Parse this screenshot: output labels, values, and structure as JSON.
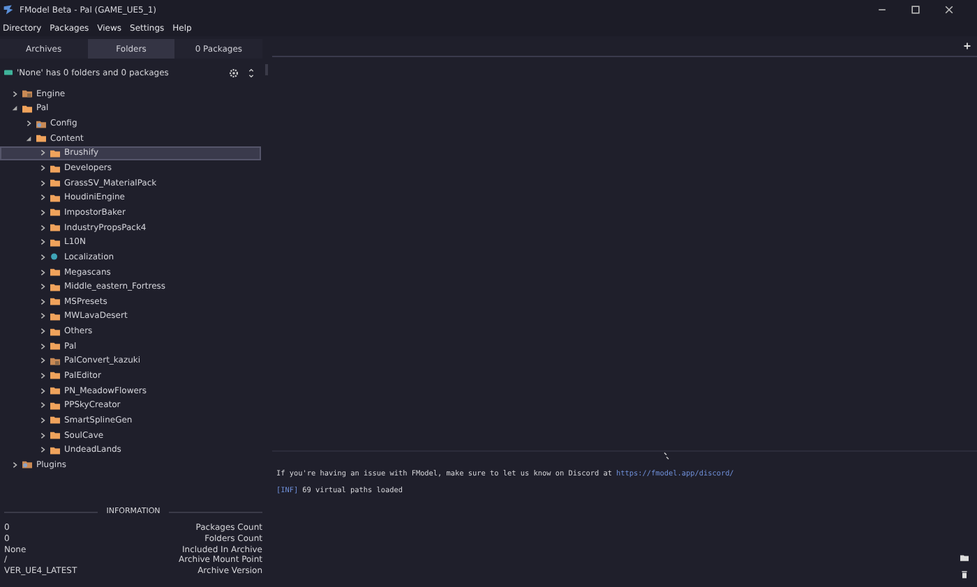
{
  "window": {
    "title": "FModel Beta - Pal (GAME_UE5_1)"
  },
  "menu": [
    "Directory",
    "Packages",
    "Views",
    "Settings",
    "Help"
  ],
  "tabs": [
    {
      "label": "Archives",
      "selected": false
    },
    {
      "label": "Folders",
      "selected": true
    },
    {
      "label": "0 Packages",
      "selected": false
    }
  ],
  "status": "'None' has 0 folders and 0 packages",
  "tree": [
    {
      "label": "Engine",
      "kind": "plugin",
      "expanded": false,
      "selected": false
    },
    {
      "label": "Pal",
      "kind": "folder",
      "expanded": true,
      "selected": false,
      "children": [
        {
          "label": "Config",
          "kind": "config",
          "expanded": false,
          "selected": false
        },
        {
          "label": "Content",
          "kind": "folder",
          "expanded": true,
          "selected": false,
          "children": [
            {
              "label": "Brushify",
              "kind": "folder",
              "expanded": false,
              "selected": true
            },
            {
              "label": "Developers",
              "kind": "folder",
              "expanded": false,
              "selected": false
            },
            {
              "label": "GrassSV_MaterialPack",
              "kind": "folder",
              "expanded": false,
              "selected": false
            },
            {
              "label": "HoudiniEngine",
              "kind": "folder",
              "expanded": false,
              "selected": false
            },
            {
              "label": "ImpostorBaker",
              "kind": "folder",
              "expanded": false,
              "selected": false
            },
            {
              "label": "IndustryPropsPack4",
              "kind": "folder",
              "expanded": false,
              "selected": false
            },
            {
              "label": "L10N",
              "kind": "folder",
              "expanded": false,
              "selected": false
            },
            {
              "label": "Localization",
              "kind": "globe",
              "expanded": false,
              "selected": false
            },
            {
              "label": "Megascans",
              "kind": "folder",
              "expanded": false,
              "selected": false
            },
            {
              "label": "Middle_eastern_Fortress",
              "kind": "folder",
              "expanded": false,
              "selected": false
            },
            {
              "label": "MSPresets",
              "kind": "folder",
              "expanded": false,
              "selected": false
            },
            {
              "label": "MWLavaDesert",
              "kind": "folder",
              "expanded": false,
              "selected": false
            },
            {
              "label": "Others",
              "kind": "folder",
              "expanded": false,
              "selected": false
            },
            {
              "label": "Pal",
              "kind": "folder",
              "expanded": false,
              "selected": false
            },
            {
              "label": "PalConvert_kazuki",
              "kind": "plugin",
              "expanded": false,
              "selected": false
            },
            {
              "label": "PalEditor",
              "kind": "folder",
              "expanded": false,
              "selected": false
            },
            {
              "label": "PN_MeadowFlowers",
              "kind": "folder",
              "expanded": false,
              "selected": false
            },
            {
              "label": "PPSkyCreator",
              "kind": "folder",
              "expanded": false,
              "selected": false
            },
            {
              "label": "SmartSplineGen",
              "kind": "folder",
              "expanded": false,
              "selected": false
            },
            {
              "label": "SoulCave",
              "kind": "folder",
              "expanded": false,
              "selected": false
            },
            {
              "label": "UndeadLands",
              "kind": "folder",
              "expanded": false,
              "selected": false
            }
          ]
        }
      ]
    },
    {
      "label": "Plugins",
      "kind": "config",
      "expanded": false,
      "selected": false
    }
  ],
  "information": {
    "title": "INFORMATION",
    "rows": [
      {
        "value": "0",
        "label": "Packages Count"
      },
      {
        "value": "0",
        "label": "Folders Count"
      },
      {
        "value": "None",
        "label": "Included In Archive"
      },
      {
        "value": "/",
        "label": "Archive Mount Point"
      },
      {
        "value": "VER_UE4_LATEST",
        "label": "Archive Version"
      }
    ]
  },
  "log": [
    {
      "kind": "link",
      "text": "If you're having an issue with FModel, make sure to let us know on Discord at",
      "link": "https://fmodel.app/discord/"
    },
    {
      "kind": "tagged",
      "tag": "[INF]",
      "text": "69 virtual paths loaded"
    }
  ]
}
